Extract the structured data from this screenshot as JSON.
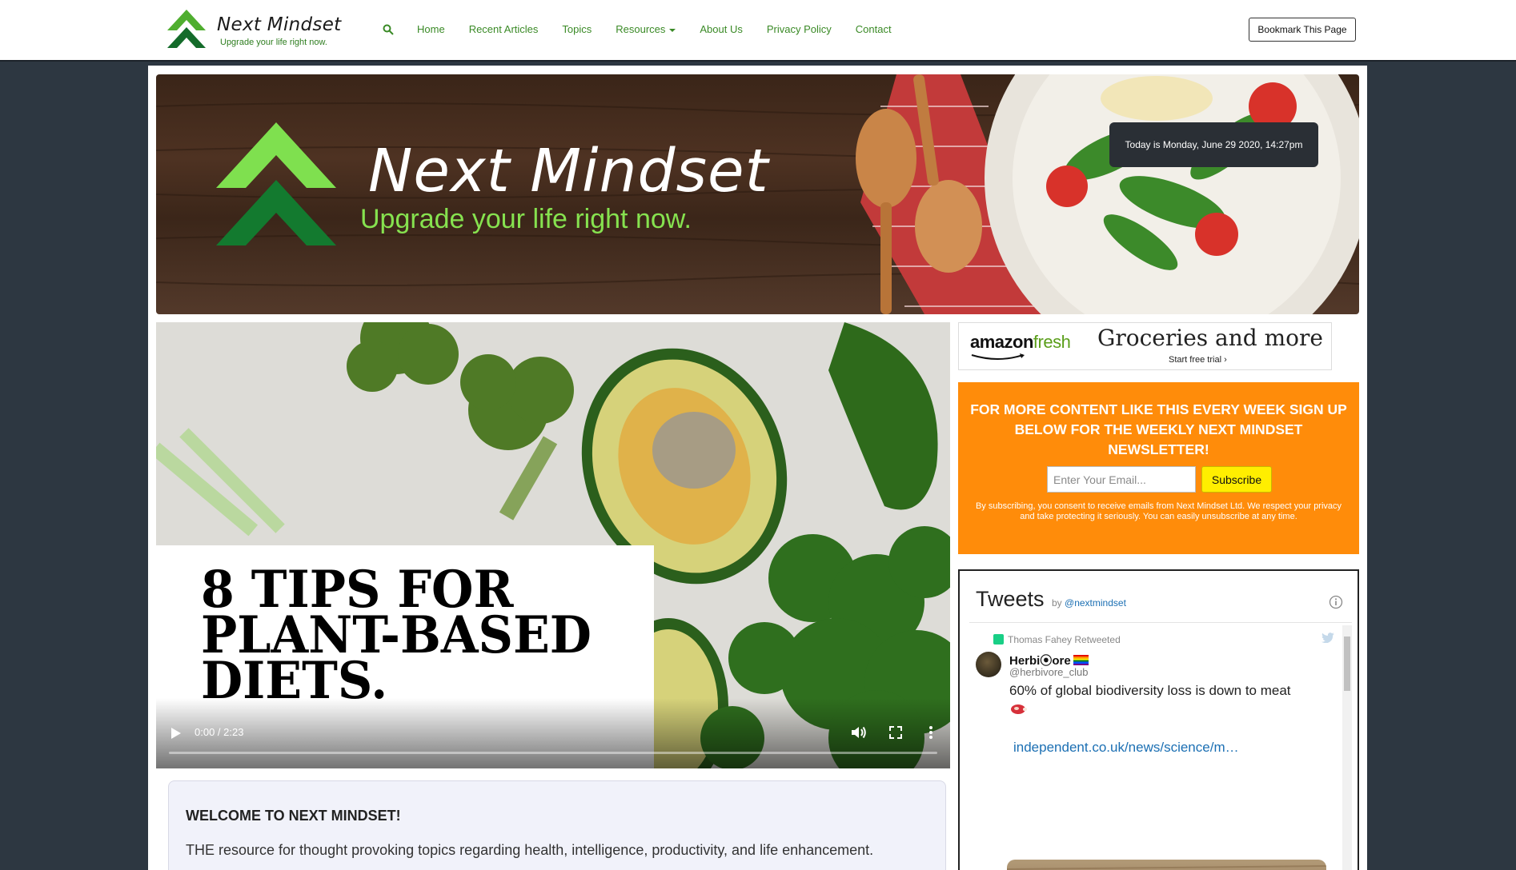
{
  "nav": {
    "brand_title": "Next Mindset",
    "brand_tagline": "Upgrade your life right now.",
    "links": [
      "Home",
      "Recent Articles",
      "Topics",
      "Resources",
      "About Us",
      "Privacy Policy",
      "Contact"
    ],
    "bookmark_label": "Bookmark This Page"
  },
  "banner": {
    "title": "Next Mindset",
    "tagline": "Upgrade your life right now.",
    "date_text": "Today is Monday, June 29 2020, 14:27pm"
  },
  "video": {
    "headline": "8 TIPS FOR\nPLANT-BASED\nDIETS.",
    "time": "0:00 / 2:23",
    "progress": 0
  },
  "welcome": {
    "title": "WELCOME TO NEXT MINDSET!",
    "body": "THE resource for thought provoking topics regarding health, intelligence, productivity, and life enhancement."
  },
  "ad": {
    "logo_amazon": "amazon",
    "logo_fresh": "fresh",
    "headline": "Groceries and more",
    "sub": "Start free trial ›"
  },
  "newsletter": {
    "heading": "FOR MORE CONTENT LIKE THIS EVERY WEEK SIGN UP BELOW FOR THE WEEKLY NEXT MINDSET NEWSLETTER!",
    "email_placeholder": "Enter Your Email...",
    "subscribe_label": "Subscribe",
    "fine_print": "By subscribing, you consent to receive emails from Next Mindset Ltd. We respect your privacy and take protecting it seriously. You can easily unsubscribe at any time."
  },
  "tweets": {
    "title": "Tweets",
    "by_prefix": "by",
    "by_handle": "@nextmindset",
    "retweeted": "Thomas Fahey Retweeted",
    "author_name": "Herbi⦿ore",
    "author_handle": "@herbivore_club",
    "text": "60% of global biodiversity loss is down to meat",
    "link": "independent.co.uk/news/science/m…"
  },
  "colors": {
    "nav_link": "#3a8a26",
    "newsletter_bg": "#ff8c0a",
    "subscribe_bg": "#ffee00",
    "page_bg": "#2d3741",
    "tweet_link": "#1b6fb3"
  }
}
